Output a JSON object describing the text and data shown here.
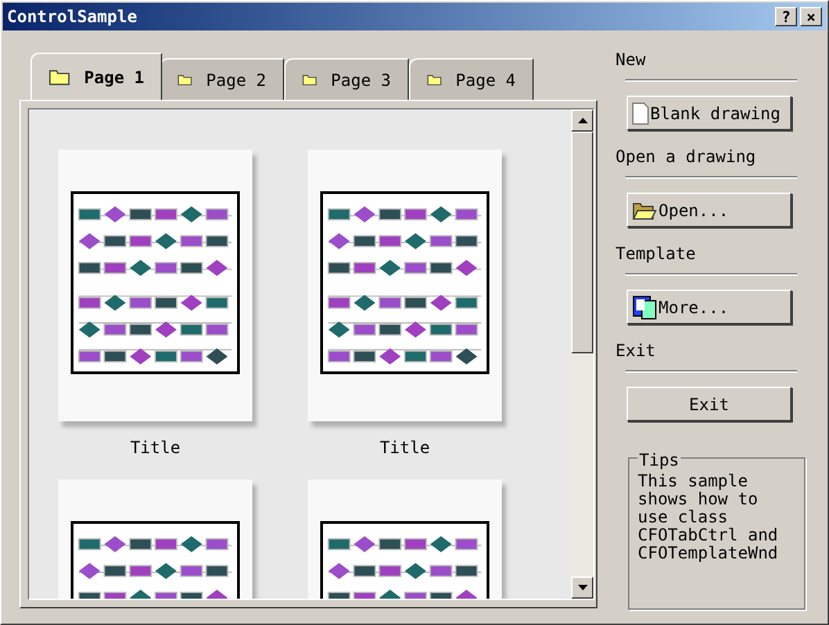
{
  "window": {
    "title": "ControlSample"
  },
  "title_buttons": [
    "?",
    "×"
  ],
  "tabs": [
    {
      "label": "Page 1",
      "selected": true
    },
    {
      "label": "Page 2",
      "selected": false
    },
    {
      "label": "Page 3",
      "selected": false
    },
    {
      "label": "Page 4",
      "selected": false
    }
  ],
  "templates": [
    {
      "kind": "captioned",
      "title": "Title"
    },
    {
      "kind": "captioned",
      "title": "Title"
    },
    {
      "kind": "uncaptioned"
    },
    {
      "kind": "uncaptioned"
    }
  ],
  "side": [
    {
      "kind": "heading",
      "text": "New"
    },
    {
      "kind": "page_button",
      "label": "Blank drawing"
    },
    {
      "kind": "heading",
      "text": "Open a drawing"
    },
    {
      "kind": "folder_button",
      "label": "Open..."
    },
    {
      "kind": "heading",
      "text": "Template"
    },
    {
      "kind": "template_button",
      "label": "More..."
    },
    {
      "kind": "heading",
      "text": "Exit"
    },
    {
      "kind": "button",
      "label": "Exit"
    }
  ],
  "tips": {
    "title": "Tips",
    "text": "This sample shows how to use class CFOTabCtrl and CFOTemplateWnd"
  }
}
